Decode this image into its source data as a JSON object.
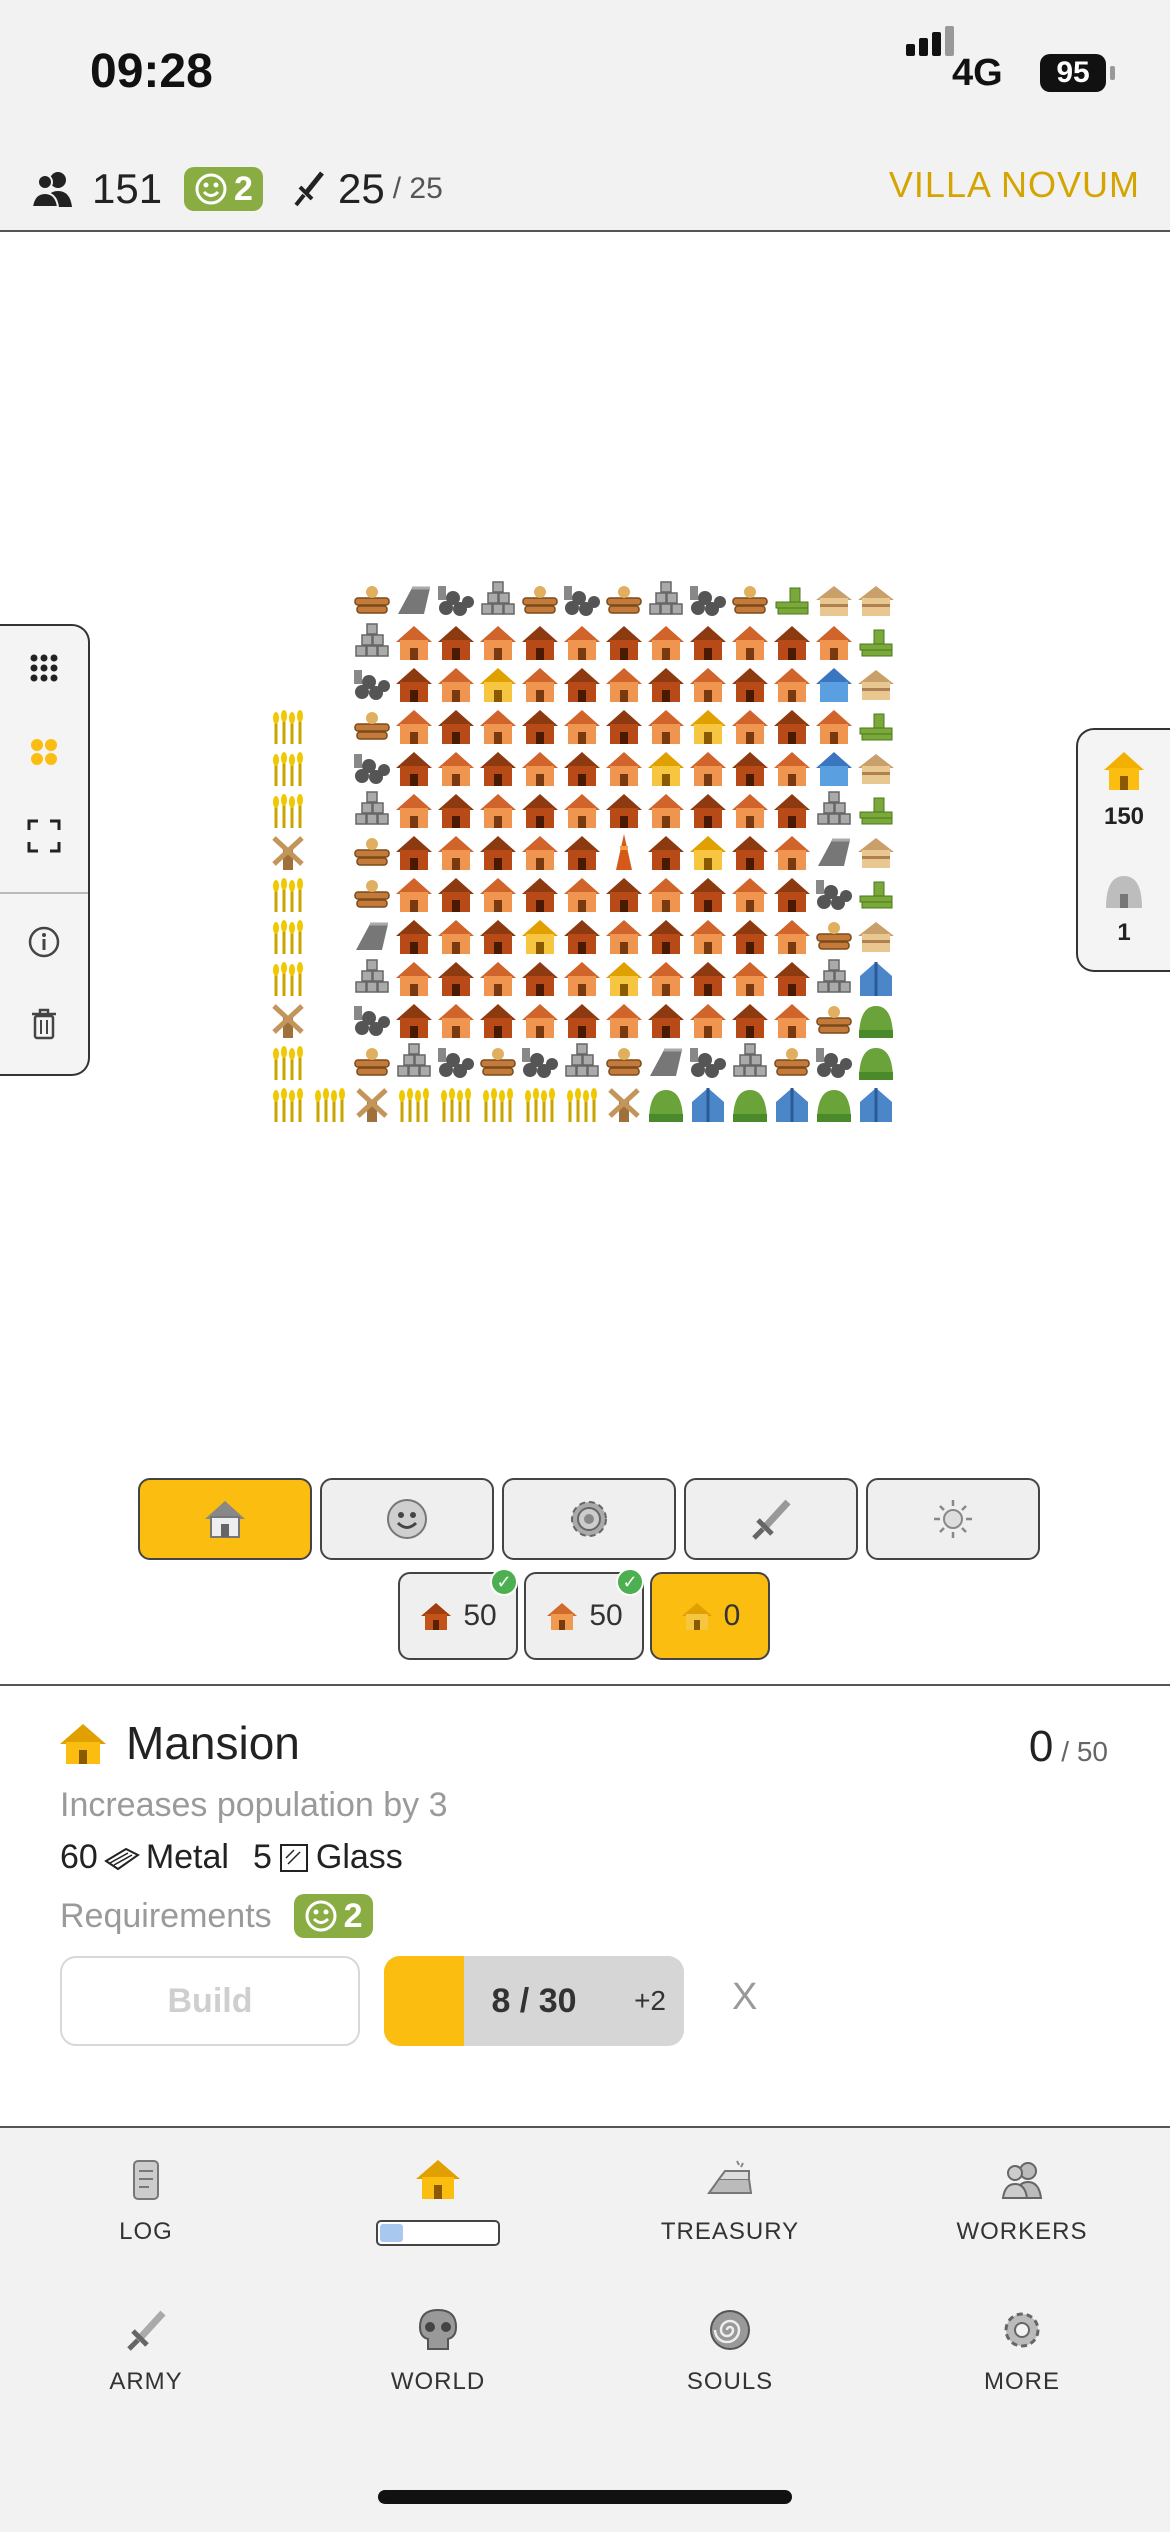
{
  "status": {
    "time": "09:28",
    "network": "4G",
    "battery": "95"
  },
  "top": {
    "population": "151",
    "happiness": "2",
    "soldiers": "25",
    "soldiers_max": "/ 25",
    "city_name": "VILLA NOVUM"
  },
  "side_right": {
    "mansion_count": "150",
    "other_count": "1"
  },
  "detail": {
    "title": "Mansion",
    "count": "0",
    "max": "/ 50",
    "description": "Increases population by 3",
    "cost1_amount": "60",
    "cost1_name": "Metal",
    "cost2_amount": "5",
    "cost2_name": "Glass",
    "requirements_label": "Requirements",
    "requirements_value": "2",
    "build_label": "Build",
    "progress_text": "8 / 30",
    "progress_fraction": 0.2667,
    "progress_extra": "+2",
    "cancel_label": "X"
  },
  "subtabs": [
    {
      "count": "50",
      "checked": true
    },
    {
      "count": "50",
      "checked": true
    },
    {
      "count": "0",
      "checked": false
    }
  ],
  "nav": {
    "log": "LOG",
    "treasury": "TREASURY",
    "workers": "WORKERS",
    "army": "ARMY",
    "world": "WORLD",
    "souls": "SOULS",
    "more": "MORE",
    "build_progress_fraction": 0.2
  },
  "colors": {
    "accent": "#fbbd10",
    "city": "#d4a400",
    "happy": "#8aad43"
  }
}
